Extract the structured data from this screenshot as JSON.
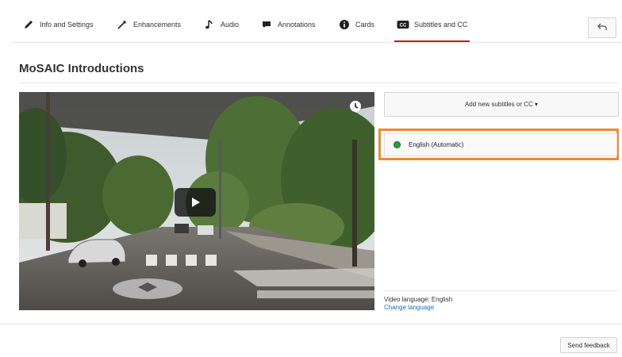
{
  "tabs": [
    {
      "label": "Info and Settings",
      "icon": "pencil-icon"
    },
    {
      "label": "Enhancements",
      "icon": "magic-wand-icon"
    },
    {
      "label": "Audio",
      "icon": "music-note-icon"
    },
    {
      "label": "Annotations",
      "icon": "speech-bubble-icon"
    },
    {
      "label": "Cards",
      "icon": "info-icon"
    },
    {
      "label": "Subtitles and CC",
      "icon": "cc-icon"
    }
  ],
  "active_tab": "Subtitles and CC",
  "accent_color": "#cc181e",
  "highlight_color": "#ef8a2e",
  "page_title": "MoSAIC Introductions",
  "video": {
    "play_icon": "play-icon",
    "clock_icon": "clock-icon"
  },
  "subtitles": {
    "add_button": "Add new subtitles or CC ▾",
    "tracks": [
      {
        "label": "English (Automatic)",
        "status_color": "#2e9b3f"
      }
    ]
  },
  "language": {
    "label": "Video language: English",
    "change_link": "Change language"
  },
  "footer": {
    "feedback_button": "Send feedback"
  }
}
